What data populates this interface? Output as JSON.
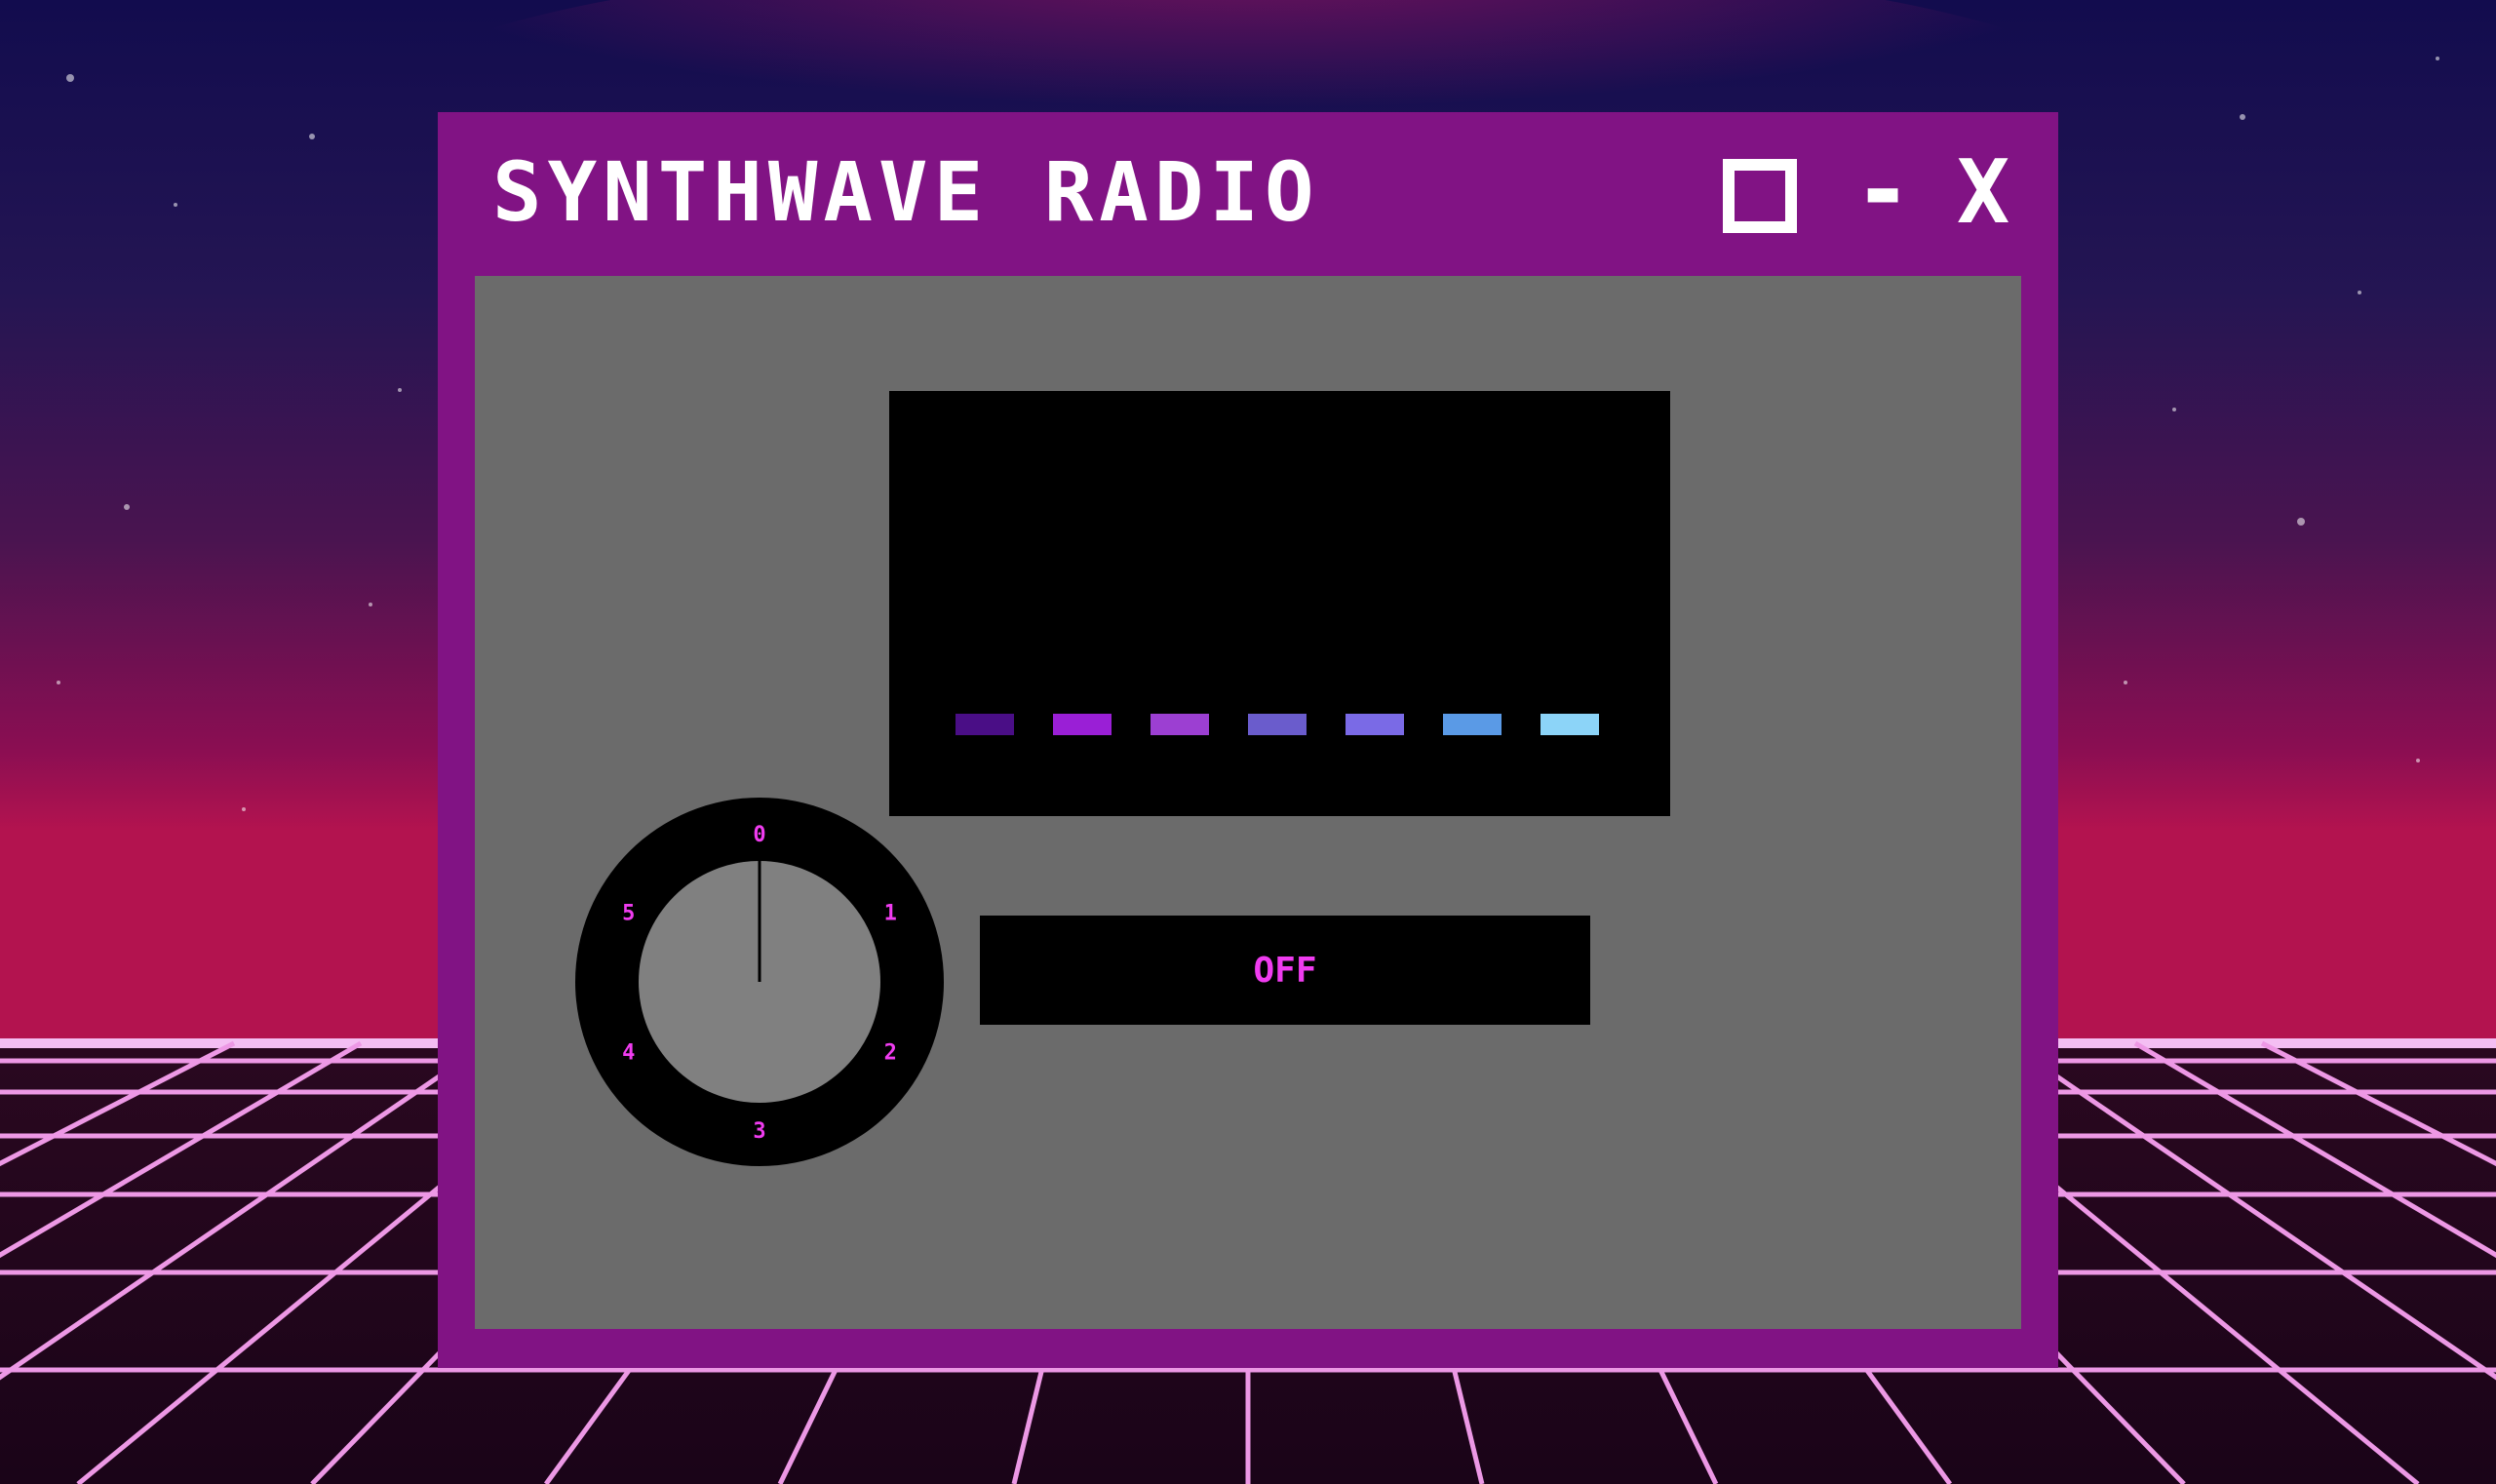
{
  "window": {
    "title": "SYNTHWAVE RADIO",
    "controls": {
      "maximize_icon": "square-outline-icon",
      "minimize_label": "-",
      "close_label": "X"
    }
  },
  "display": {
    "level_bars": [
      {
        "color": "#4a0e86"
      },
      {
        "color": "#9a1fd6"
      },
      {
        "color": "#9c3fd2"
      },
      {
        "color": "#6a5ccc"
      },
      {
        "color": "#7a6ae6"
      },
      {
        "color": "#5a9ae6"
      },
      {
        "color": "#8cd4f8"
      }
    ]
  },
  "tuner": {
    "labels": [
      "0",
      "1",
      "2",
      "3",
      "4",
      "5"
    ],
    "value": 0
  },
  "power": {
    "status_label": "OFF"
  },
  "colors": {
    "window_frame": "#811384",
    "panel": "#6b6b6b",
    "accent": "#f03cf0"
  }
}
